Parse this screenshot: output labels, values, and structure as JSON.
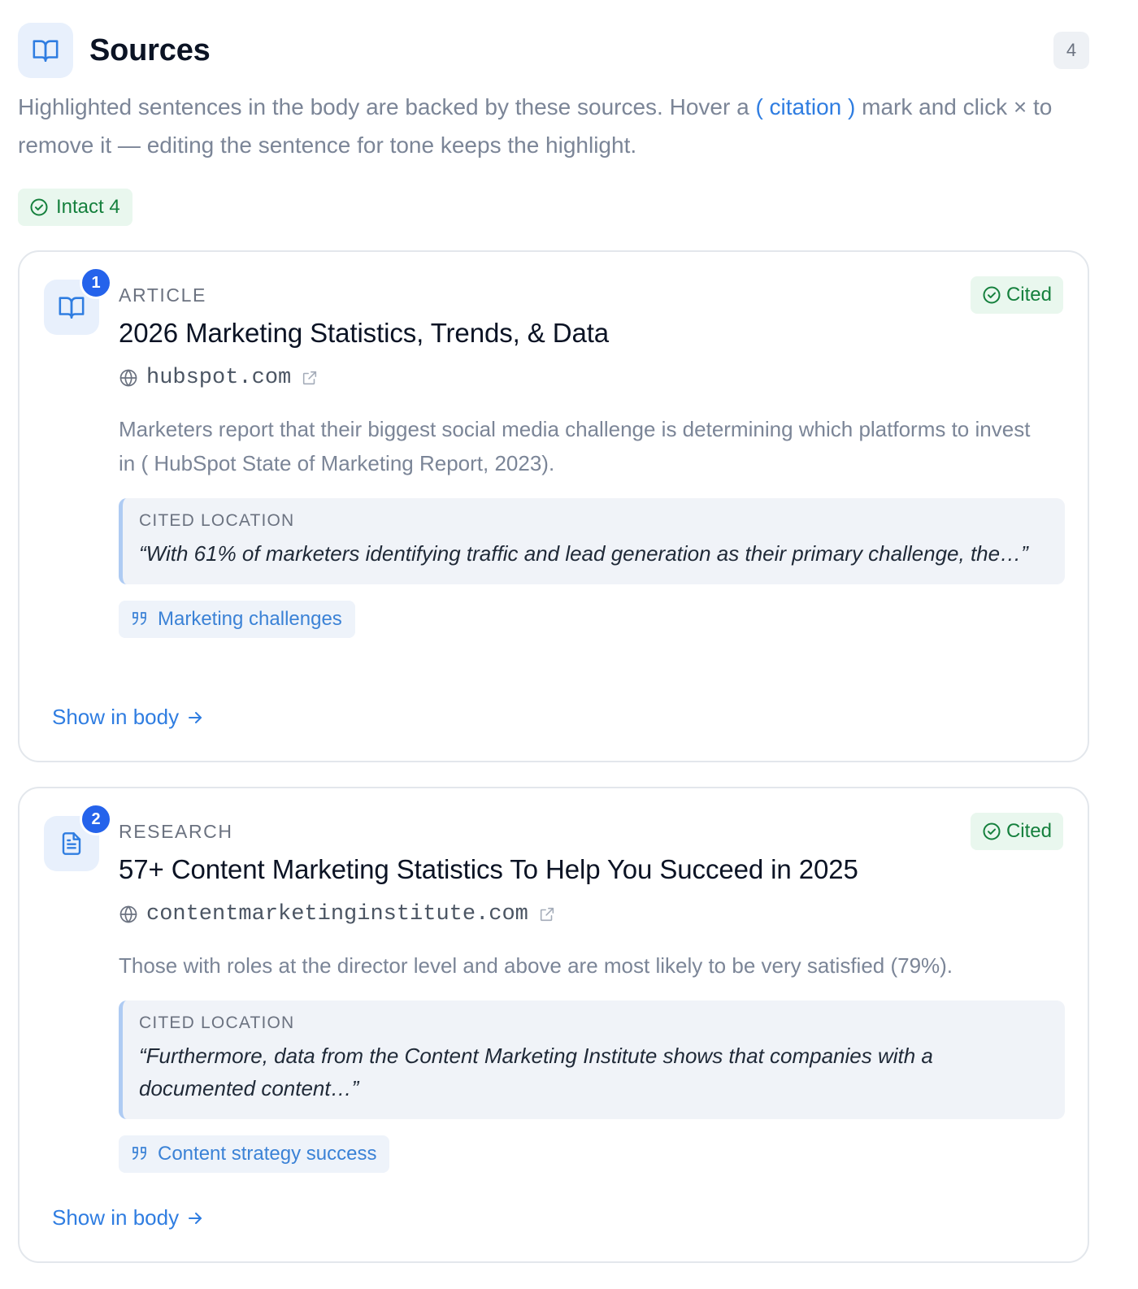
{
  "header": {
    "title": "Sources",
    "count": "4",
    "icon": "book-open-icon"
  },
  "intro": {
    "text_before": "Highlighted sentences in the body are backed by these sources. Hover a ",
    "citation": "( citation )",
    "text_after": " mark and click × to remove it — editing the sentence for tone keeps the highlight."
  },
  "status": {
    "intact_label": "Intact 4"
  },
  "colors": {
    "accent": "#2f7de1",
    "badge": "#2563eb",
    "success": "#15803d",
    "success_bg": "#e9f7ee"
  },
  "sources": [
    {
      "number": "1",
      "icon": "book-open-icon",
      "type": "ARTICLE",
      "status": "Cited",
      "title": "2026 Marketing Statistics, Trends, & Data",
      "domain": "hubspot.com",
      "excerpt": "Marketers report that their biggest social media challenge is determining which platforms to invest in ( HubSpot State of Marketing Report, 2023).",
      "cited_location_label": "CITED LOCATION",
      "cited_location_quote": "“With 61% of marketers identifying traffic and lead generation as their primary challenge, the…”",
      "topic": "Marketing challenges",
      "show_link": "Show in body"
    },
    {
      "number": "2",
      "icon": "document-icon",
      "type": "RESEARCH",
      "status": "Cited",
      "title": "57+ Content Marketing Statistics To Help You Succeed in 2025",
      "domain": "contentmarketinginstitute.com",
      "excerpt": "Those with roles at the director level and above are most likely to be very satisfied (79%).",
      "cited_location_label": "CITED LOCATION",
      "cited_location_quote": "“Furthermore, data from the Content Marketing Institute shows that companies with a documented content…”",
      "topic": "Content strategy success",
      "show_link": "Show in body"
    }
  ]
}
